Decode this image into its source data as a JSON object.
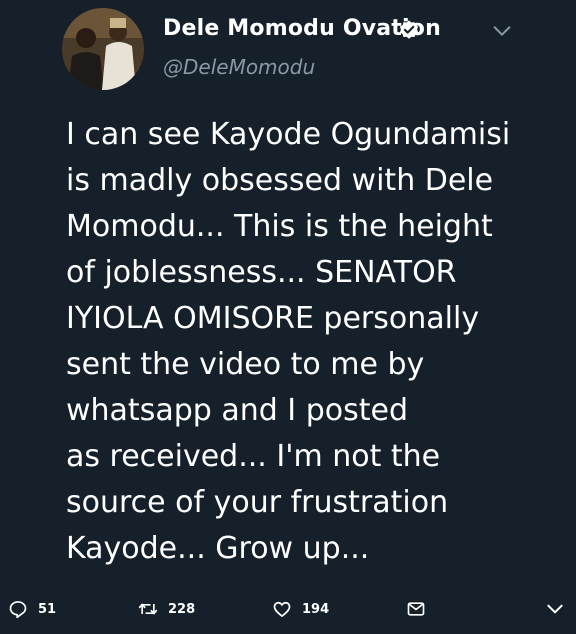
{
  "author": {
    "display_name": "Dele Momodu Ovation",
    "handle": "@DeleMomodu",
    "verified": true
  },
  "tweet": {
    "lines": [
      "I can see Kayode Ogundamisi",
      "is madly obsessed with Dele",
      "Momodu... This is the height",
      "of joblessness... SENATOR",
      "IYIOLA OMISORE personally",
      "sent the video to me by",
      "whatsapp and I posted",
      "as received... I'm not the",
      "source of your frustration",
      "Kayode... Grow up..."
    ]
  },
  "actions": {
    "replies": "51",
    "retweets": "228",
    "likes": "194"
  },
  "icons": {
    "verified": "verified-badge-icon",
    "menu": "chevron-down-icon",
    "reply": "reply-icon",
    "retweet": "retweet-icon",
    "like": "heart-icon",
    "message": "envelope-icon",
    "more": "chevron-down-icon"
  },
  "colors": {
    "background": "#15202b",
    "text": "#ffffff",
    "muted": "#8899a6"
  }
}
